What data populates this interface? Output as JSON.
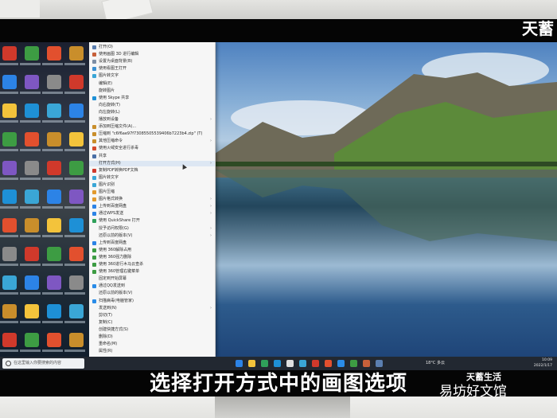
{
  "corner_logo": "天蓄",
  "context_menu": {
    "items": [
      {
        "label": "打开(O)",
        "icon": "open-icon",
        "color": "#5b7fb0"
      },
      {
        "label": "使用画图 3D 进行编辑",
        "icon": "paint3d-icon",
        "color": "#c7603a"
      },
      {
        "label": "设置为桌面背景(B)",
        "icon": "desktop-bg-icon",
        "color": "#7d8ea5"
      },
      {
        "label": "使用看图王打开",
        "icon": "viewer-icon",
        "color": "#3b8fd1"
      },
      {
        "label": "图片转文字",
        "icon": "ocr-icon",
        "color": "#3aa6d6"
      },
      {
        "label": "编辑(E)",
        "icon": "",
        "color": ""
      },
      {
        "label": "旋转图片",
        "icon": "",
        "color": ""
      },
      {
        "label": "使用 Skype 共享",
        "icon": "skype-icon",
        "color": "#1e90d6"
      },
      {
        "label": "向右旋转(T)",
        "icon": "",
        "color": ""
      },
      {
        "label": "向左旋转(L)",
        "icon": "",
        "color": ""
      },
      {
        "label": "播放到设备",
        "icon": "",
        "color": "",
        "arrow": true
      },
      {
        "label": "添加到压缩文件(A)...",
        "icon": "zip-icon",
        "color": "#c98e2b"
      },
      {
        "label": "压缩到 \"c6f6ae97f73085505539406b7223b4.zip\" (T)",
        "icon": "zip-icon",
        "color": "#c98e2b"
      },
      {
        "label": "其他压缩命令",
        "icon": "zip-icon",
        "color": "#c98e2b",
        "arrow": true
      },
      {
        "label": "使用火绒安全进行杀毒",
        "icon": "huorong-icon",
        "color": "#d54a2c"
      },
      {
        "label": "共享",
        "icon": "share-icon",
        "color": "#4a6fa5"
      },
      {
        "label": "打开方式(H)",
        "icon": "",
        "color": "",
        "arrow": true,
        "highlight": true
      },
      {
        "label": "复制PDF转换PDF文档",
        "icon": "pdf-icon",
        "color": "#d0392b"
      },
      {
        "label": "图片转文字",
        "icon": "ocr-icon",
        "color": "#3aa6d6"
      },
      {
        "label": "图片识别",
        "icon": "ocr-icon",
        "color": "#3aa6d6"
      },
      {
        "label": "图片压缩",
        "icon": "compress-icon",
        "color": "#e29a2e"
      },
      {
        "label": "图片格式转换",
        "icon": "convert-icon",
        "color": "#e29a2e",
        "arrow": true
      },
      {
        "label": "上传到百度网盘",
        "icon": "baidu-icon",
        "color": "#2c83e6",
        "arrow": true
      },
      {
        "label": "通过WPS发送",
        "icon": "wps-icon",
        "color": "#2c83e6",
        "arrow": true
      },
      {
        "label": "使用 QuickShare 打开",
        "icon": "quickshare-icon",
        "color": "#2fa05a"
      },
      {
        "label": "授予访问权限(G)",
        "icon": "",
        "color": "",
        "arrow": true
      },
      {
        "label": "还原以前的版本(V)",
        "icon": "",
        "color": "",
        "arrow": true
      },
      {
        "label": "上传到百度网盘",
        "icon": "baidu-icon",
        "color": "#2c83e6"
      },
      {
        "label": "使用 360解除占用",
        "icon": "360-icon",
        "color": "#3d9c43"
      },
      {
        "label": "使用 360强力删除",
        "icon": "360-icon",
        "color": "#3d9c43"
      },
      {
        "label": "使用 360进行木马云查杀",
        "icon": "360-icon",
        "color": "#3d9c43"
      },
      {
        "label": "使用 360管理右键菜单",
        "icon": "360-icon",
        "color": "#3d9c43"
      },
      {
        "label": "固定到开始屏幕",
        "icon": "",
        "color": ""
      },
      {
        "label": "通过QQ发送到",
        "icon": "qq-icon",
        "color": "#2a8ce8"
      },
      {
        "label": "还原以前的版本(V)",
        "icon": "",
        "color": ""
      },
      {
        "label": "扫描病毒(电脑管家)",
        "icon": "tencent-icon",
        "color": "#2a8ce8"
      },
      {
        "label": "发送到(N)",
        "icon": "",
        "color": "",
        "arrow": true
      },
      {
        "label": "剪切(T)",
        "icon": "",
        "color": ""
      },
      {
        "label": "复制(C)",
        "icon": "",
        "color": ""
      },
      {
        "label": "创建快捷方式(S)",
        "icon": "",
        "color": ""
      },
      {
        "label": "删除(D)",
        "icon": "",
        "color": ""
      },
      {
        "label": "重命名(M)",
        "icon": "",
        "color": ""
      },
      {
        "label": "属性(R)",
        "icon": "",
        "color": ""
      }
    ]
  },
  "taskbar": {
    "search_placeholder": "在这里输入你要搜索的内容",
    "weather": "18°C 多云",
    "time": "10:09",
    "date": "2022/1/17"
  },
  "subtitle": "选择打开方式中的画图选项",
  "watermark": {
    "line1": "天蓄生活",
    "line2": "易坊好文馆"
  }
}
